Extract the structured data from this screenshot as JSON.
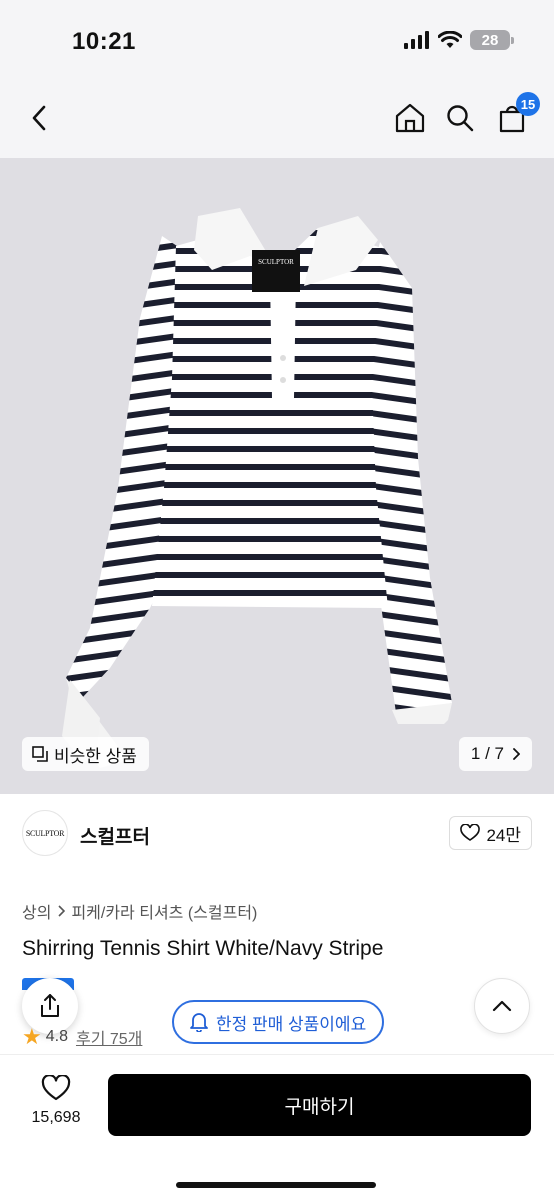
{
  "status_bar": {
    "time": "10:21",
    "battery": "28"
  },
  "header": {
    "cart_count": "15"
  },
  "hero": {
    "label_text": "SCULPTOR",
    "similar_label": "비슷한 상품",
    "pager": "1 / 7"
  },
  "brand": {
    "logo_text": "SCULPTOR",
    "name": "스컬프터",
    "likes": "24만"
  },
  "breadcrumb": {
    "root": "상의",
    "sub": "피케/카라 티셔츠 (스컬프터)"
  },
  "product": {
    "title": "Shirring Tennis Shirt White/Navy Stripe",
    "rating": "4.8",
    "reviews": "후기 75개",
    "limited_label": "한정 판매 상품이에요"
  },
  "bottom": {
    "wish_count": "15,698",
    "buy_label": "구매하기"
  },
  "colors": {
    "accent": "#1e73e8",
    "stripe": "#1b1e2e",
    "background": "#dfdee3"
  }
}
